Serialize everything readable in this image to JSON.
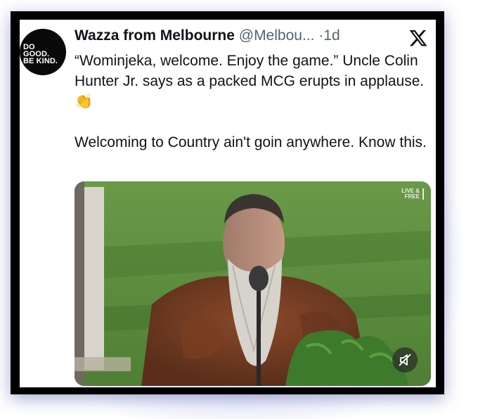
{
  "avatar": {
    "lines": [
      "DO",
      "GOOD.",
      "BE KIND."
    ]
  },
  "tweet": {
    "author_name": "Wazza from Melbourne",
    "handle": "@Melbou...",
    "separator": "·",
    "time": "1d",
    "emoji": "👏",
    "paragraph1": "“Wominjeka, welcome. Enjoy the game.” Uncle Colin Hunter Jr. says as a packed MCG erupts in applause.",
    "paragraph2": "Welcoming to Country ain't goin anywhere. Know this."
  },
  "media": {
    "badge_line1": "LIVE &",
    "badge_line2": "FREE",
    "mute_icon": "speaker-muted-icon"
  },
  "platform_icon": "x-logo-icon"
}
